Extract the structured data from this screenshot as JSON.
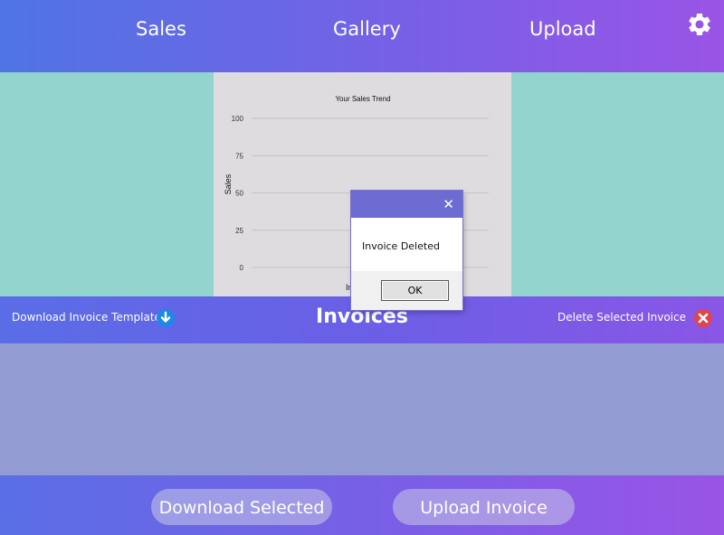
{
  "nav": {
    "items": [
      {
        "label": "Sales"
      },
      {
        "label": "Gallery"
      },
      {
        "label": "Upload"
      }
    ],
    "settings_icon": "gear-icon"
  },
  "chart_data": {
    "type": "line",
    "title": "Your Sales Trend",
    "ylabel": "Sales",
    "xlabel": "In",
    "y_ticks": [
      100,
      75,
      50,
      25,
      0
    ],
    "ylim": [
      0,
      100
    ],
    "series": [],
    "grid": true
  },
  "invoices": {
    "title": "Invoices",
    "download_template_label": "Download Invoice Template",
    "download_icon": "download-circle-icon",
    "delete_label": "Delete Selected Invoice",
    "delete_icon": "close-circle-icon",
    "rows": []
  },
  "actions": {
    "download_selected": "Download Selected",
    "upload_invoice": "Upload Invoice"
  },
  "dialog": {
    "message": "Invoice Deleted",
    "ok_label": "OK",
    "close_glyph": "✕"
  },
  "colors": {
    "accent_blue": "#4f74e3",
    "accent_purple": "#9a54e6",
    "teal_background": "#94d4cf",
    "list_background": "#939bd3",
    "delete_red": "#e0444c",
    "download_blue": "#1e88e5"
  }
}
